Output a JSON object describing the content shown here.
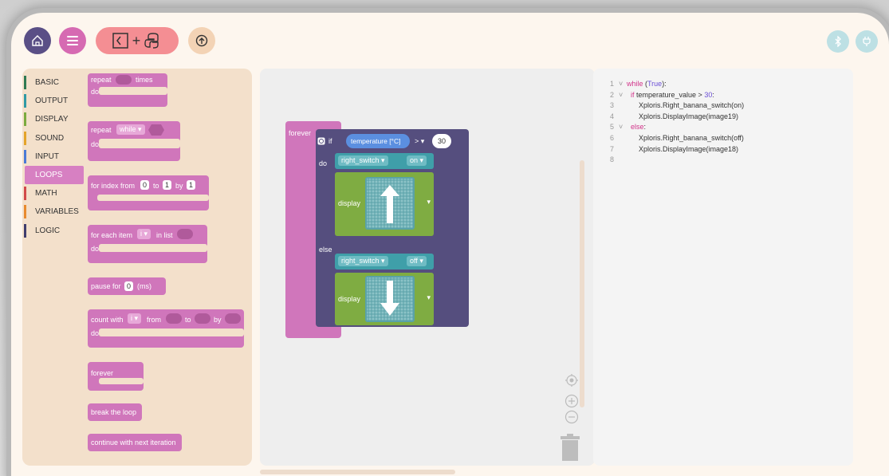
{
  "toolbar": {
    "home_icon": "home-icon",
    "menu_icon": "hamburger-icon",
    "mode_plus": "+",
    "upload_icon": "upload-icon",
    "bluetooth_icon": "bluetooth-icon",
    "plug_icon": "plug-icon"
  },
  "categories": [
    {
      "label": "BASIC",
      "color": "#2f7a53"
    },
    {
      "label": "OUTPUT",
      "color": "#2f9aa6"
    },
    {
      "label": "DISPLAY",
      "color": "#7bab3f"
    },
    {
      "label": "SOUND",
      "color": "#e4a42b"
    },
    {
      "label": "INPUT",
      "color": "#4b7bd6"
    },
    {
      "label": "LOOPS",
      "color": "#d780c2"
    },
    {
      "label": "MATH",
      "color": "#d24a4a"
    },
    {
      "label": "VARIABLES",
      "color": "#e88a2e"
    },
    {
      "label": "LOGIC",
      "color": "#3f3d6e"
    }
  ],
  "palette": {
    "repeat": "repeat",
    "times": "times",
    "do": "do",
    "repeat2": "repeat",
    "while": "while ▾",
    "for_index": "for index from",
    "zero": "0",
    "to": "to",
    "one": "1",
    "by": "by",
    "one2": "1",
    "for_each": "for each item",
    "i": "i ▾",
    "in_list": "in list",
    "pause_for": "pause for",
    "pause_val": "0",
    "ms": "(ms)",
    "count_with": "count with",
    "from": "from",
    "forever": "forever",
    "break": "break the loop",
    "continue": "continue with next iteration"
  },
  "program": {
    "forever": "forever",
    "if": "if",
    "temperature": "temperature [°C]",
    "op": "> ▾",
    "threshold": "30",
    "do": "do",
    "else": "else",
    "right_switch": "right_switch ▾",
    "on": "on ▾",
    "off": "off ▾",
    "display": "display"
  },
  "code": [
    {
      "n": "1",
      "fold": "˅",
      "parts": [
        {
          "cls": "kw",
          "t": "while "
        },
        {
          "cls": "",
          "t": "("
        },
        {
          "cls": "val",
          "t": "True"
        },
        {
          "cls": "",
          "t": "):"
        }
      ]
    },
    {
      "n": "2",
      "fold": "˅",
      "parts": [
        {
          "cls": "kw",
          "t": "  if "
        },
        {
          "cls": "",
          "t": "temperature_value > "
        },
        {
          "cls": "val",
          "t": "30"
        },
        {
          "cls": "",
          "t": ":"
        }
      ]
    },
    {
      "n": "3",
      "fold": "",
      "parts": [
        {
          "cls": "",
          "t": "      Xploris.Right_banana_switch(on)"
        }
      ]
    },
    {
      "n": "4",
      "fold": "",
      "parts": [
        {
          "cls": "",
          "t": "      Xploris.DisplayImage(image19)"
        }
      ]
    },
    {
      "n": "5",
      "fold": "˅",
      "parts": [
        {
          "cls": "kw",
          "t": "  else"
        },
        {
          "cls": "",
          "t": ":"
        }
      ]
    },
    {
      "n": "6",
      "fold": "",
      "parts": [
        {
          "cls": "",
          "t": "      Xploris.Right_banana_switch(off)"
        }
      ]
    },
    {
      "n": "7",
      "fold": "",
      "parts": [
        {
          "cls": "",
          "t": "      Xploris.DisplayImage(image18)"
        }
      ]
    },
    {
      "n": "8",
      "fold": "",
      "parts": []
    }
  ],
  "workspace_controls": {
    "recenter_icon": "recenter-icon",
    "zoom_in_icon": "zoom-in-icon",
    "zoom_out_icon": "zoom-out-icon",
    "trash_icon": "trash-icon"
  }
}
